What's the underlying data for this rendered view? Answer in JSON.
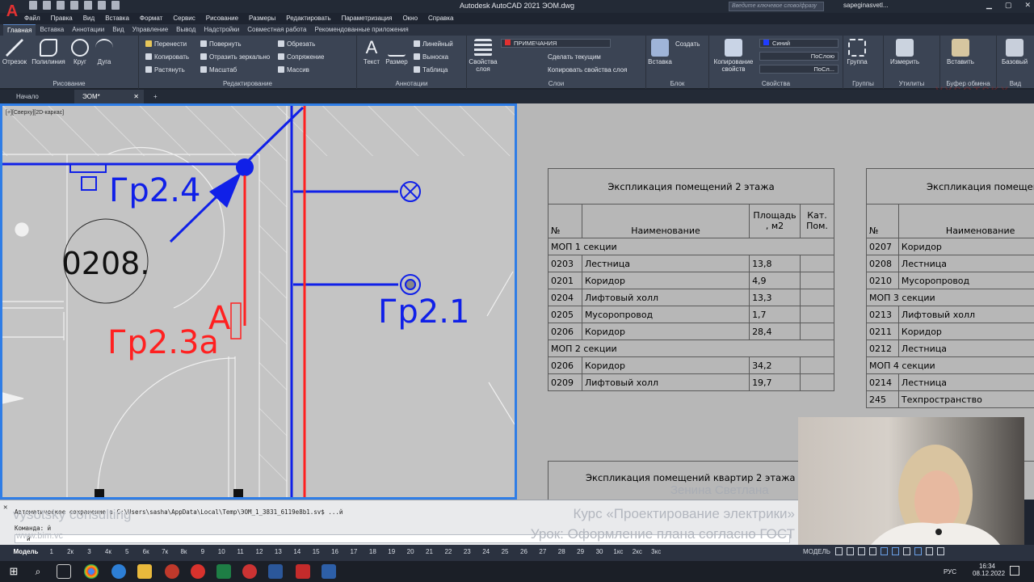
{
  "titlebar": {
    "app_title": "Autodesk AutoCAD 2021   ЭОМ.dwg",
    "search_placeholder": "Введите ключевое слово/фразу",
    "user": "sapeginasvetl...",
    "logo": "A"
  },
  "menu": [
    "Файл",
    "Правка",
    "Вид",
    "Вставка",
    "Формат",
    "Сервис",
    "Рисование",
    "Размеры",
    "Редактировать",
    "Параметризация",
    "Окно",
    "Справка"
  ],
  "ribbon_tabs": [
    "Главная",
    "Вставка",
    "Аннотации",
    "Вид",
    "Управление",
    "Вывод",
    "Надстройки",
    "Совместная работа",
    "Рекомендованные приложения"
  ],
  "ribbon": {
    "draw": {
      "label": "Рисование",
      "line": "Отрезок",
      "polyline": "Полилиния",
      "circle": "Круг",
      "arc": "Дуга"
    },
    "modify": {
      "label": "Редактирование",
      "move": "Перенести",
      "rotate": "Повернуть",
      "trim": "Обрезать",
      "copy": "Копировать",
      "mirror": "Отразить зеркально",
      "fillet": "Сопряжение",
      "stretch": "Растянуть",
      "scale": "Масштаб",
      "array": "Массив"
    },
    "annotation": {
      "label": "Аннотации",
      "text": "Текст",
      "dimension": "Размер",
      "linear": "Линейный",
      "leader": "Выноска",
      "table": "Таблица"
    },
    "layers": {
      "label": "Слои",
      "props": "Свойства слоя",
      "current_layer": "ПРИМЕЧАНИЯ",
      "make_current": "Сделать текущим",
      "match": "Копировать свойства слоя"
    },
    "block": {
      "label": "Блок",
      "insert": "Вставка",
      "create": "Создать"
    },
    "properties": {
      "label": "Свойства",
      "match": "Копирование свойств",
      "color": "Синий",
      "linetype": "ПоСлою",
      "lineweight": "ПоСл..."
    },
    "groups": {
      "label": "Группы",
      "group": "Группа"
    },
    "utilities": {
      "label": "Утилиты",
      "measure": "Измерить"
    },
    "clipboard": {
      "label": "Буфер обмена",
      "paste": "Вставить"
    },
    "view": {
      "label": "Вид",
      "base": "Базовый"
    }
  },
  "doc_tabs": [
    "Начало",
    "ЭОМ*"
  ],
  "viewport_label": "[+][Сверху][2D-каркас]",
  "drawing": {
    "room_number": "0208.",
    "labels": {
      "gr24": "Гр2.4",
      "gr21": "Гр2.1",
      "gr23a": "Гр2.3а",
      "a": "А"
    }
  },
  "table1": {
    "title": "Экспликация помещений 2 этажа",
    "headers": [
      "№",
      "Наименование",
      "Площадь , м2",
      "Кат. Пом."
    ],
    "rows": [
      {
        "section": "МОП 1 секции"
      },
      {
        "num": "0203",
        "name": "Лестница",
        "area": "13,8"
      },
      {
        "num": "0201",
        "name": "Коридор",
        "area": "4,9"
      },
      {
        "num": "0204",
        "name": "Лифтовый холл",
        "area": "13,3"
      },
      {
        "num": "0205",
        "name": "Мусоропровод",
        "area": "1,7"
      },
      {
        "num": "0206",
        "name": "Коридор",
        "area": "28,4"
      },
      {
        "section": "МОП 2 секции"
      },
      {
        "num": "0206",
        "name": "Коридор",
        "area": "34,2"
      },
      {
        "num": "0209",
        "name": "Лифтовый холл",
        "area": "19,7"
      }
    ]
  },
  "table2": {
    "title": "Экспликация помещен",
    "headers": [
      "№",
      "Наименование"
    ],
    "rows": [
      {
        "num": "0207",
        "name": "Коридор"
      },
      {
        "num": "0208",
        "name": "Лестница"
      },
      {
        "num": "0210",
        "name": "Мусоропровод"
      },
      {
        "section": "МОП 3 секции"
      },
      {
        "num": "0213",
        "name": "Лифтовый холл"
      },
      {
        "num": "0211",
        "name": "Коридор"
      },
      {
        "num": "0212",
        "name": "Лестница"
      },
      {
        "section": "МОП 4 секции"
      },
      {
        "num": "0214",
        "name": "Лестница"
      },
      {
        "num": "245",
        "name": "Техпространство"
      }
    ]
  },
  "table3_title": "Экспликация помещений квартир 2 этажа",
  "overlay": {
    "author": "Зенина Светлана",
    "course": "Курс «Проектирование электрики»",
    "lesson": "Урок: Оформление плана согласно ГОСТ",
    "brand": "vysotsky consulting",
    "site": "www.bim.vc",
    "logo_text": "VYSOTSKY"
  },
  "command": {
    "line1": "Автоматическое сохранение в C:\\Users\\sasha\\AppData\\Local\\Temp\\ЭОМ_1_3831_6119e8b1.sv$ ...й",
    "line2": "Команда: й",
    "prompt": "й"
  },
  "layout_tabs": [
    "Модель",
    "1",
    "2к",
    "3",
    "4к",
    "5",
    "6к",
    "7к",
    "8к",
    "9",
    "10",
    "11",
    "12",
    "13",
    "14",
    "15",
    "16",
    "17",
    "18",
    "19",
    "20",
    "21",
    "22",
    "23",
    "24",
    "25",
    "26",
    "27",
    "28",
    "29",
    "30",
    "1кс",
    "2кс",
    "3кс"
  ],
  "status": {
    "model": "МОДЕЛЬ"
  },
  "tray": {
    "lang": "РУС",
    "time": "16:34",
    "date": "08.12.2022"
  }
}
